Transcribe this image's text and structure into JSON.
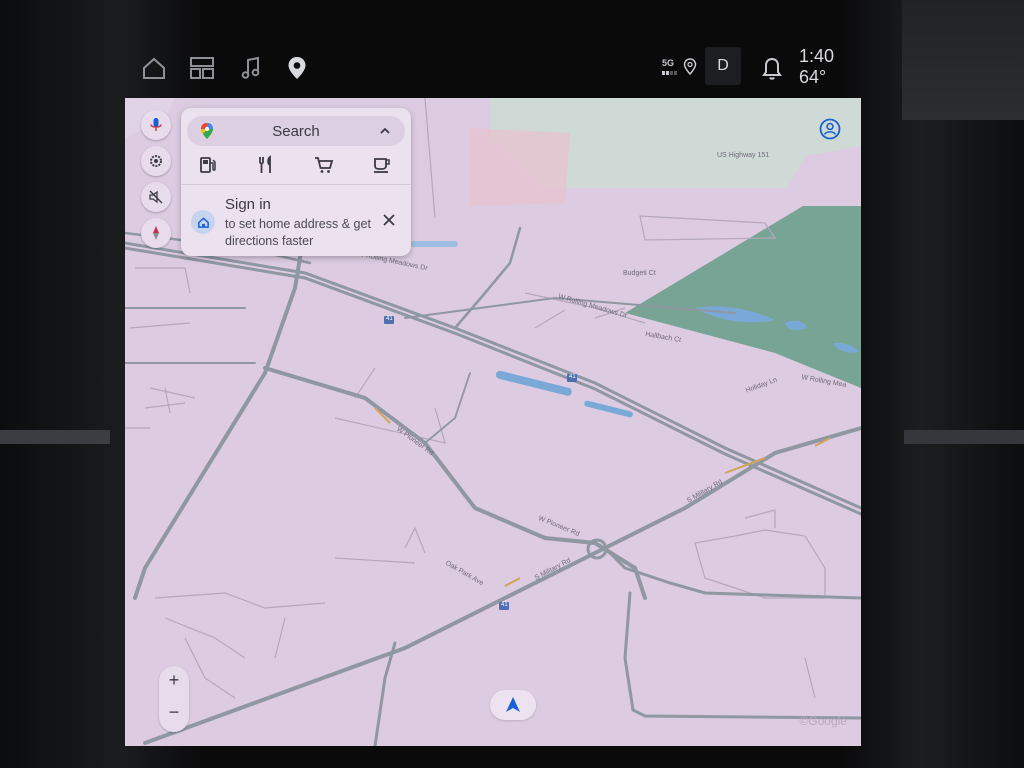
{
  "top_nav": {
    "icons": [
      "home-icon",
      "apps-grid-icon",
      "music-note-icon",
      "map-pin-icon"
    ]
  },
  "status": {
    "network": "5G",
    "drive_mode": "D",
    "time": "1:40",
    "temperature": "64°"
  },
  "map_controls": {
    "icons": [
      "microphone-icon",
      "settings-icon",
      "sound-off-icon",
      "compass-icon"
    ],
    "zoom_in": "+",
    "zoom_out": "−"
  },
  "search_card": {
    "search_label": "Search",
    "categories": [
      "gas-station-icon",
      "restaurant-icon",
      "shopping-cart-icon",
      "coffee-icon"
    ],
    "signin_title": "Sign in",
    "signin_subtitle": "to set home address & get directions faster"
  },
  "map": {
    "road_labels": [
      "W Rolling Meadows Dr",
      "W Rolling Meadows Dr",
      "W Pioneer Rd",
      "W Pioneer Rd",
      "S Military Rd",
      "S Military Rd",
      "Oak Park Ave",
      "US Highway 151",
      "Budgeti Ct",
      "Hallbach Ct",
      "W Rolling Mea",
      "Holiday Ln"
    ],
    "highway_shields": [
      "41",
      "41",
      "41"
    ],
    "watermark": "©Google"
  },
  "colors": {
    "map_background": "#dccbe1",
    "road": "#7f8690",
    "water": "#7aa9d8",
    "park": "#78a496",
    "accent_blue": "#1a5fd3"
  }
}
